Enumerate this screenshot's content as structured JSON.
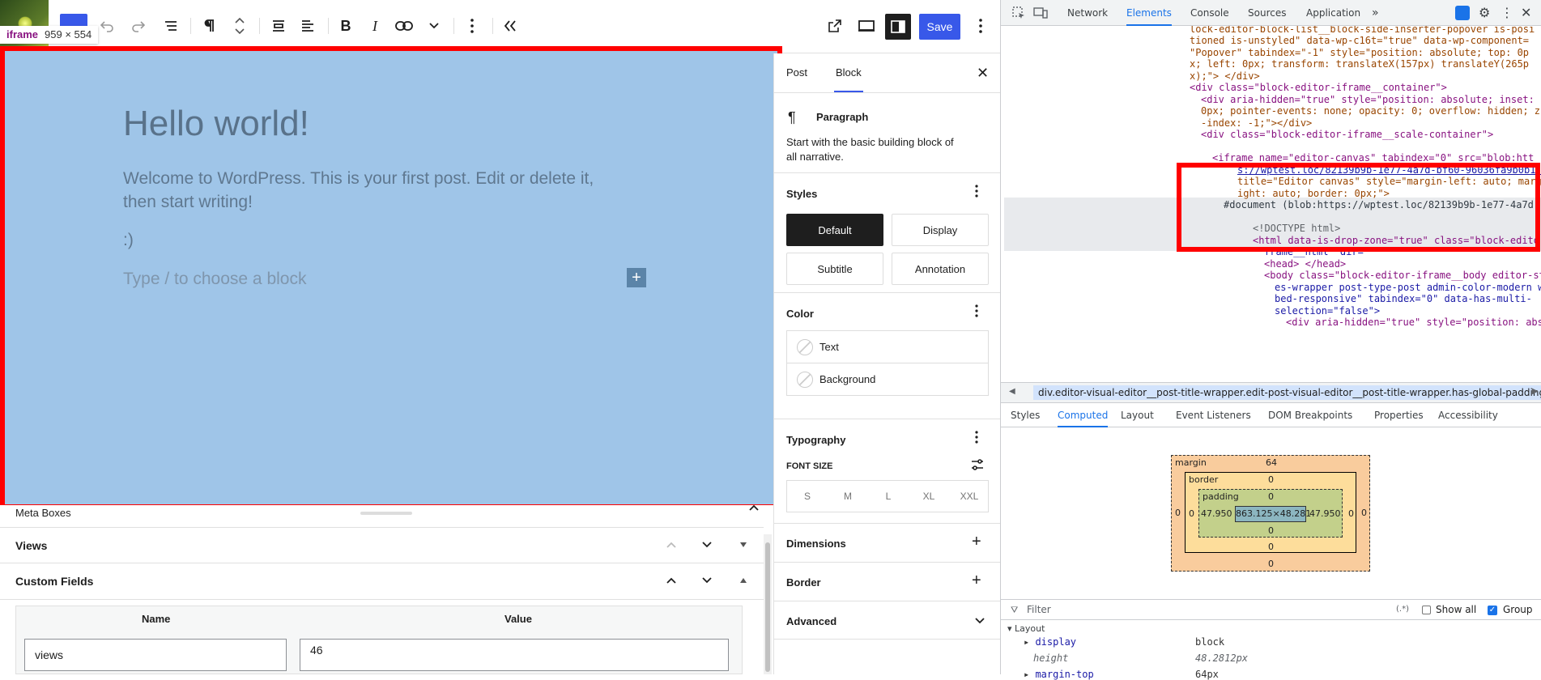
{
  "toolbar": {
    "save_label": "Save",
    "iframe_tooltip_name": "iframe",
    "iframe_tooltip_dims": "959 × 554"
  },
  "post": {
    "title": "Hello world!",
    "paragraph1": "Welcome to WordPress. This is your first post. Edit or delete it, then start writing!",
    "paragraph2": ":)",
    "placeholder": "Type / to choose a block"
  },
  "meta": {
    "heading": "Meta Boxes",
    "views_label": "Views",
    "custom_fields_label": "Custom Fields",
    "col_name": "Name",
    "col_value": "Value",
    "field_name": "views",
    "field_value": "46"
  },
  "settings": {
    "tab_post": "Post",
    "tab_block": "Block",
    "block_name": "Paragraph",
    "block_desc": "Start with the basic building block of all narrative.",
    "styles_title": "Styles",
    "styles": [
      "Default",
      "Display",
      "Subtitle",
      "Annotation"
    ],
    "color_title": "Color",
    "color_text": "Text",
    "color_background": "Background",
    "typography_title": "Typography",
    "font_size_label": "FONT SIZE",
    "font_sizes": [
      "S",
      "M",
      "L",
      "XL",
      "XXL"
    ],
    "dimensions_title": "Dimensions",
    "border_title": "Border",
    "advanced_title": "Advanced"
  },
  "devtools": {
    "tabs": [
      "Network",
      "Elements",
      "Console",
      "Sources",
      "Application"
    ],
    "active_tab": "Elements",
    "breadcrumb": "div.editor-visual-editor__post-title-wrapper.edit-post-visual-editor__post-title-wrapper.has-global-padding",
    "subtabs": [
      "Styles",
      "Computed",
      "Layout",
      "Event Listeners",
      "DOM Breakpoints",
      "Properties",
      "Accessibility"
    ],
    "active_subtab": "Computed",
    "boxmodel": {
      "margin_label": "margin",
      "margin_top": "64",
      "margin_bottom": "0",
      "margin_left": "0",
      "margin_right": "0",
      "border_label": "border",
      "border_top": "0",
      "border_bottom": "0",
      "border_left": "0",
      "border_right": "0",
      "padding_label": "padding",
      "padding_top": "0",
      "padding_bottom": "0",
      "padding_left": "47.950",
      "padding_right": "47.950",
      "content": "863.125×48.281"
    },
    "filter_placeholder": "Filter",
    "filter_regex": "(.*)",
    "show_all_label": "Show all",
    "group_label": "Group",
    "layout_group": "Layout",
    "prop_display_name": "display",
    "prop_display_value": "block",
    "prop_height_name": "height",
    "prop_height_value": "48.2812px",
    "prop_margin_top_name": "margin-top",
    "prop_margin_top_value": "64px",
    "dom_lines": [
      "lock-editor-block-list__block-side-inserter-popover is-posi",
      "tioned is-unstyled\" data-wp-c16t=\"true\" data-wp-component=",
      "\"Popover\" tabindex=\"-1\" style=\"position: absolute; top: 0p",
      "x; left: 0px; transform: translateX(157px) translateY(265p",
      "x);\"> </div>",
      "<div class=\"block-editor-iframe__container\">",
      "<div aria-hidden=\"true\" style=\"position: absolute; inset:",
      "0px; pointer-events: none; opacity: 0; overflow: hidden; z",
      "-index: -1;\"></div>",
      "<div class=\"block-editor-iframe__scale-container\">",
      "<iframe name=\"editor-canvas\" tabindex=\"0\" src=\"blob:htt",
      "s://wptest.loc/82139b9b-1e77-4a7d-bf60-96036fa9b0b1\"",
      "title=\"Editor canvas\" style=\"margin-left: auto; margin-",
      "ight: auto; border: 0px;\">",
      "#document (blob:https://wptest.loc/82139b9b-1e77-4a7d",
      "<!DOCTYPE html>",
      "<html data-is-drop-zone=\"true\" class=\"block-editor-i",
      "frame__html\" dir=",
      "<head> </head>",
      "<body class=\"block-editor-iframe__body editor-styl",
      "es-wrapper post-type-post admin-color-modern wp-em",
      "bed-responsive\" tabindex=\"0\" data-has-multi-",
      "selection=\"false\">",
      "<div aria-hidden=\"true\" style=\"position: absolut"
    ]
  }
}
